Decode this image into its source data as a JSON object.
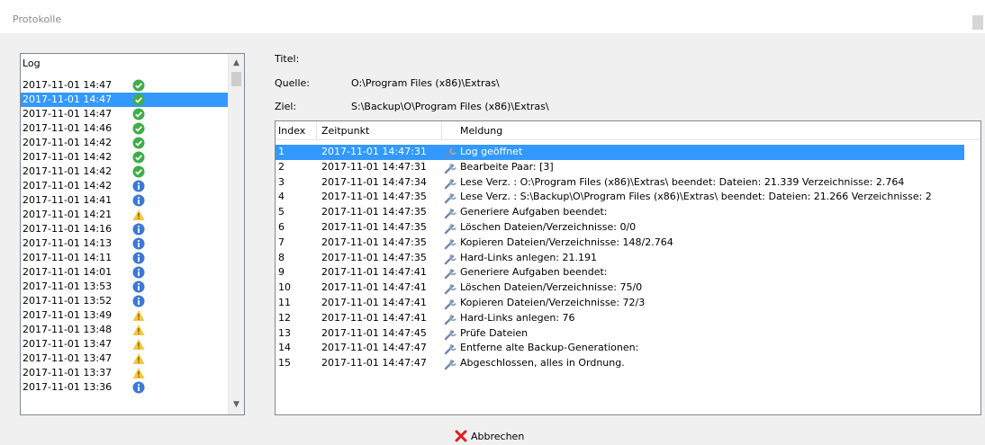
{
  "window": {
    "title": "Protokolle"
  },
  "log_list": {
    "header": "Log",
    "items": [
      {
        "time": "2017-11-01 14:47",
        "status": "success",
        "selected": false
      },
      {
        "time": "2017-11-01 14:47",
        "status": "success",
        "selected": true
      },
      {
        "time": "2017-11-01 14:47",
        "status": "success",
        "selected": false
      },
      {
        "time": "2017-11-01 14:46",
        "status": "success",
        "selected": false
      },
      {
        "time": "2017-11-01 14:42",
        "status": "success",
        "selected": false
      },
      {
        "time": "2017-11-01 14:42",
        "status": "success",
        "selected": false
      },
      {
        "time": "2017-11-01 14:42",
        "status": "success",
        "selected": false
      },
      {
        "time": "2017-11-01 14:42",
        "status": "info",
        "selected": false
      },
      {
        "time": "2017-11-01 14:41",
        "status": "info",
        "selected": false
      },
      {
        "time": "2017-11-01 14:21",
        "status": "warning",
        "selected": false
      },
      {
        "time": "2017-11-01 14:16",
        "status": "info",
        "selected": false
      },
      {
        "time": "2017-11-01 14:13",
        "status": "info",
        "selected": false
      },
      {
        "time": "2017-11-01 14:11",
        "status": "info",
        "selected": false
      },
      {
        "time": "2017-11-01 14:01",
        "status": "info",
        "selected": false
      },
      {
        "time": "2017-11-01 13:53",
        "status": "info",
        "selected": false
      },
      {
        "time": "2017-11-01 13:52",
        "status": "info",
        "selected": false
      },
      {
        "time": "2017-11-01 13:49",
        "status": "warning",
        "selected": false
      },
      {
        "time": "2017-11-01 13:48",
        "status": "warning",
        "selected": false
      },
      {
        "time": "2017-11-01 13:47",
        "status": "warning",
        "selected": false
      },
      {
        "time": "2017-11-01 13:47",
        "status": "warning",
        "selected": false
      },
      {
        "time": "2017-11-01 13:37",
        "status": "warning",
        "selected": false
      },
      {
        "time": "2017-11-01 13:36",
        "status": "info",
        "selected": false
      }
    ]
  },
  "details": {
    "title_label": "Titel:",
    "title_value": "",
    "source_label": "Quelle:",
    "source_value": "O:\\Program Files (x86)\\Extras\\",
    "target_label": "Ziel:",
    "target_value": "S:\\Backup\\O\\Program Files (x86)\\Extras\\"
  },
  "table": {
    "columns": [
      "Index",
      "Zeitpunkt",
      "Meldung"
    ],
    "rows": [
      {
        "index": "1",
        "time": "2017-11-01 14:47:31",
        "message": "Log geöffnet",
        "selected": true
      },
      {
        "index": "2",
        "time": "2017-11-01 14:47:31",
        "message": "Bearbeite Paar:  [3]",
        "selected": false
      },
      {
        "index": "3",
        "time": "2017-11-01 14:47:34",
        "message": "Lese Verz.   : O:\\Program Files (x86)\\Extras\\ beendet: Dateien: 21.339 Verzeichnisse: 2.764",
        "selected": false
      },
      {
        "index": "4",
        "time": "2017-11-01 14:47:35",
        "message": "Lese Verz.   : S:\\Backup\\O\\Program Files (x86)\\Extras\\ beendet: Dateien: 21.266 Verzeichnisse: 2",
        "selected": false
      },
      {
        "index": "5",
        "time": "2017-11-01 14:47:35",
        "message": "Generiere Aufgaben beendet:",
        "selected": false
      },
      {
        "index": "6",
        "time": "2017-11-01 14:47:35",
        "message": "Löschen Dateien/Verzeichnisse: 0/0",
        "selected": false
      },
      {
        "index": "7",
        "time": "2017-11-01 14:47:35",
        "message": "Kopieren Dateien/Verzeichnisse: 148/2.764",
        "selected": false
      },
      {
        "index": "8",
        "time": "2017-11-01 14:47:35",
        "message": "Hard-Links anlegen: 21.191",
        "selected": false
      },
      {
        "index": "9",
        "time": "2017-11-01 14:47:41",
        "message": "Generiere Aufgaben beendet:",
        "selected": false
      },
      {
        "index": "10",
        "time": "2017-11-01 14:47:41",
        "message": "Löschen Dateien/Verzeichnisse: 75/0",
        "selected": false
      },
      {
        "index": "11",
        "time": "2017-11-01 14:47:41",
        "message": "Kopieren Dateien/Verzeichnisse: 72/3",
        "selected": false
      },
      {
        "index": "12",
        "time": "2017-11-01 14:47:41",
        "message": "Hard-Links anlegen: 76",
        "selected": false
      },
      {
        "index": "13",
        "time": "2017-11-01 14:47:45",
        "message": "Prüfe Dateien",
        "selected": false
      },
      {
        "index": "14",
        "time": "2017-11-01 14:47:47",
        "message": "Entferne alte Backup-Generationen:",
        "selected": false
      },
      {
        "index": "15",
        "time": "2017-11-01 14:47:47",
        "message": "Abgeschlossen, alles in Ordnung.",
        "selected": false
      }
    ]
  },
  "buttons": {
    "cancel_label": "Abbrechen"
  },
  "icons": {
    "status_success": "check-circle-icon",
    "status_info": "info-circle-icon",
    "status_warning": "warning-triangle-icon",
    "message": "wrench-icon",
    "cancel": "red-x-icon"
  },
  "colors": {
    "selection": "#3399ff",
    "success": "#3fae49",
    "info": "#3b78d8",
    "warning": "#f5c542",
    "cancel_x": "#e02020"
  }
}
